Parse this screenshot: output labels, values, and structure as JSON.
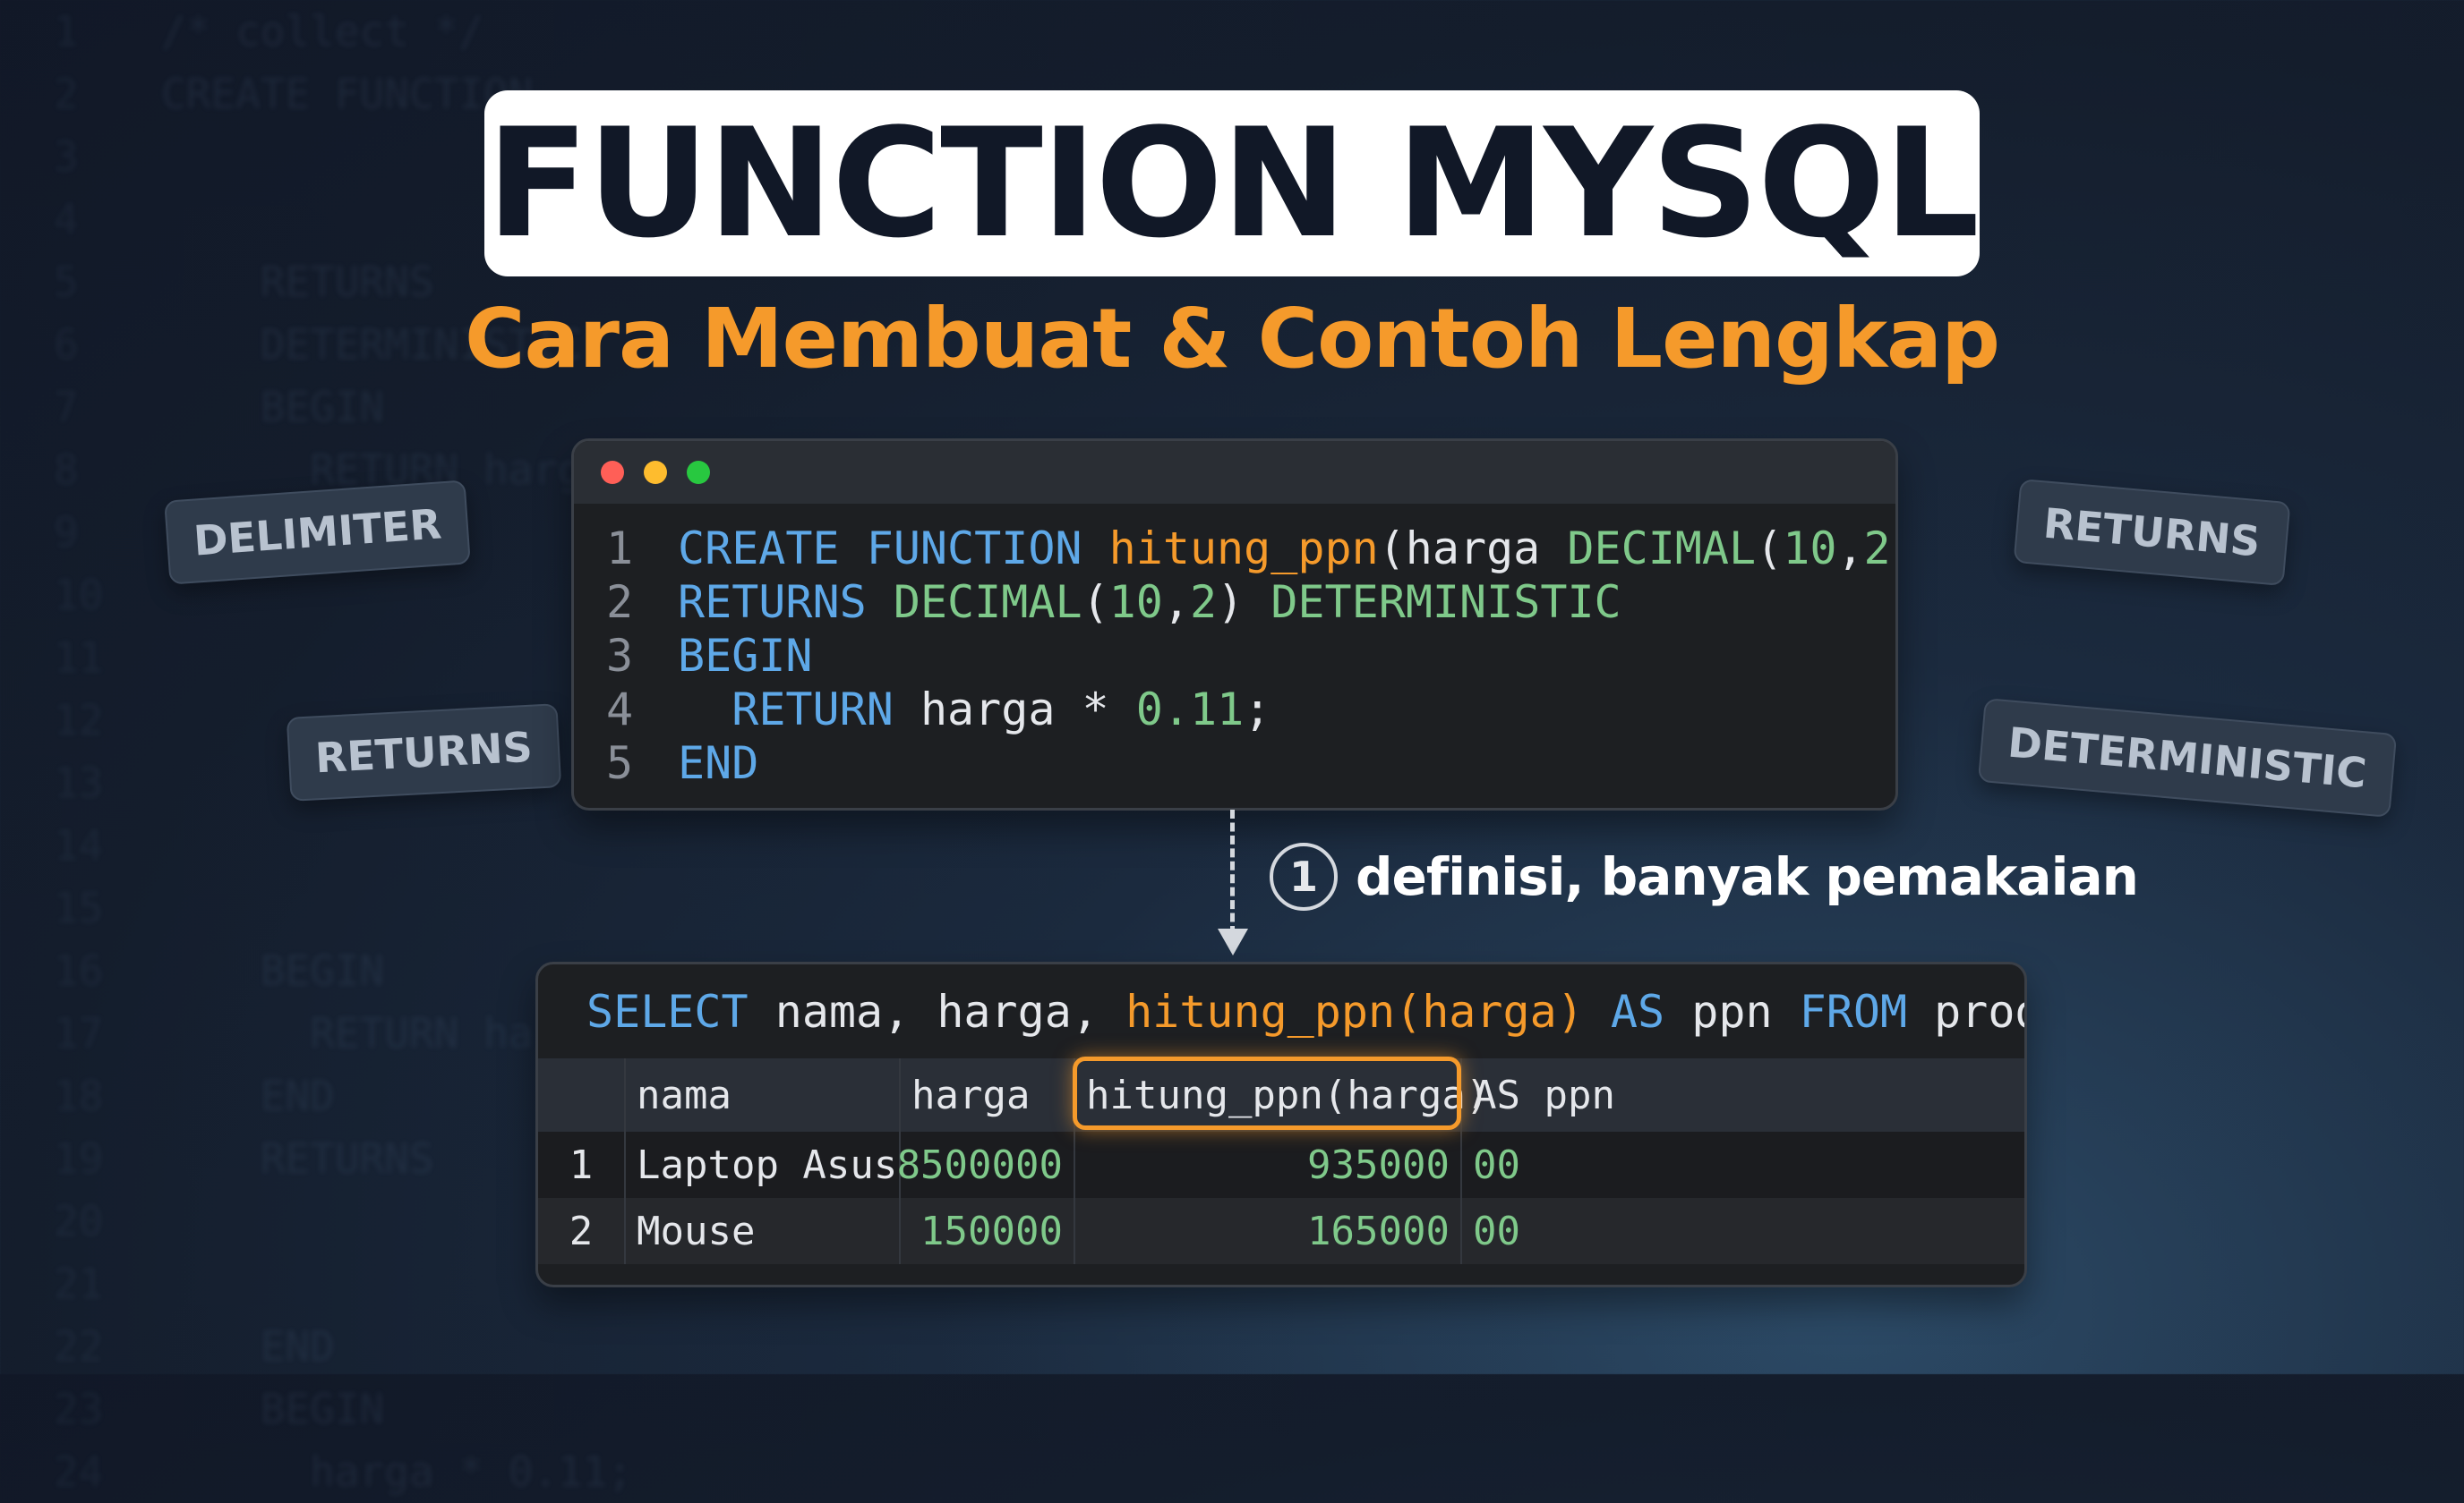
{
  "title": "FUNCTION MYSQL",
  "subtitle": "Cara Membuat & Contoh Lengkap",
  "tags": {
    "delimiter": "DELIMITER",
    "returns_left": "RETURNS",
    "returns_right": "RETURNS",
    "deterministic": "DETERMINISTIC"
  },
  "editor": {
    "lines": [
      {
        "n": "1",
        "t": [
          {
            "k": "kw",
            "s": "CREATE FUNCTION "
          },
          {
            "k": "fn",
            "s": "hitung_ppn"
          },
          {
            "k": "pl",
            "s": "(harga "
          },
          {
            "k": "ty",
            "s": "DECIMAL"
          },
          {
            "k": "pl",
            "s": "("
          },
          {
            "k": "nm",
            "s": "10"
          },
          {
            "k": "pl",
            "s": ","
          },
          {
            "k": "nm",
            "s": "2"
          },
          {
            "k": "pl",
            "s": "))"
          }
        ]
      },
      {
        "n": "2",
        "t": [
          {
            "k": "kw",
            "s": "RETURNS "
          },
          {
            "k": "ty",
            "s": "DECIMAL"
          },
          {
            "k": "pl",
            "s": "("
          },
          {
            "k": "nm",
            "s": "10"
          },
          {
            "k": "pl",
            "s": ","
          },
          {
            "k": "nm",
            "s": "2"
          },
          {
            "k": "pl",
            "s": ") "
          },
          {
            "k": "ty",
            "s": "DETERMINISTIC"
          }
        ]
      },
      {
        "n": "3",
        "t": [
          {
            "k": "kw",
            "s": "BEGIN"
          }
        ]
      },
      {
        "n": "4",
        "t": [
          {
            "k": "pl",
            "s": "  "
          },
          {
            "k": "kw",
            "s": "RETURN "
          },
          {
            "k": "pl",
            "s": "harga * "
          },
          {
            "k": "nm",
            "s": "0.11"
          },
          {
            "k": "pl",
            "s": ";"
          }
        ]
      },
      {
        "n": "5",
        "t": [
          {
            "k": "kw",
            "s": "END"
          }
        ]
      }
    ]
  },
  "step": {
    "number": "1",
    "text": "definisi, banyak pemakaian"
  },
  "result": {
    "query": [
      {
        "k": "kw",
        "s": "SELECT "
      },
      {
        "k": "pl",
        "s": "nama, harga, "
      },
      {
        "k": "fn",
        "s": "hitung_ppn(harga) "
      },
      {
        "k": "kw",
        "s": "AS "
      },
      {
        "k": "pl",
        "s": "ppn "
      },
      {
        "k": "kw",
        "s": "FROM "
      },
      {
        "k": "pl",
        "s": "produk"
      }
    ],
    "headers": [
      "",
      "nama",
      "harga",
      "hitung_ppn(harga)",
      "AS ppn"
    ],
    "rows": [
      [
        "1",
        "Laptop Asus",
        "8500000",
        "935000",
        "00"
      ],
      [
        "2",
        "Mouse",
        "150000",
        "165000",
        "00"
      ]
    ]
  },
  "colors": {
    "accent_orange": "#f59a2b",
    "keyword_blue": "#5ea8e8",
    "type_green": "#7fc98a",
    "title_dark": "#111827",
    "dot_red": "#ff5f57",
    "dot_yellow": "#febc2e",
    "dot_green": "#28c840"
  },
  "icons": [
    "close-dot-icon",
    "minimize-dot-icon",
    "maximize-dot-icon",
    "arrow-down-icon"
  ]
}
